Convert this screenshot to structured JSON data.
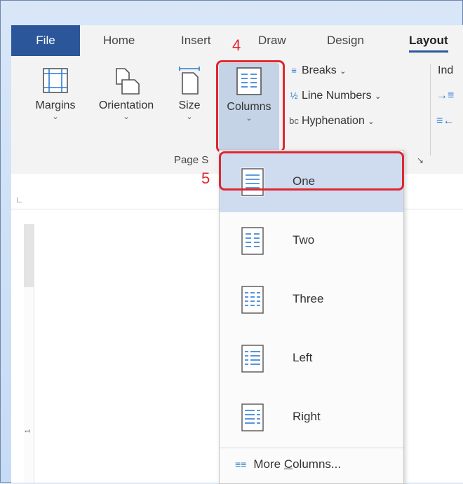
{
  "tabs": {
    "file": "File",
    "home": "Home",
    "insert": "Insert",
    "draw": "Draw",
    "design": "Design",
    "layout": "Layout"
  },
  "ribbon": {
    "margins": "Margins",
    "orientation": "Orientation",
    "size": "Size",
    "columns": "Columns",
    "breaks": "Breaks",
    "line_numbers": "Line Numbers",
    "hyphenation": "Hyphenation",
    "group_label": "Page S",
    "indent_partial": "Ind"
  },
  "steps": {
    "step4": "4",
    "step5": "5"
  },
  "columns_menu": {
    "items": [
      {
        "label": "One",
        "selected": true
      },
      {
        "label": "Two",
        "selected": false
      },
      {
        "label": "Three",
        "selected": false
      },
      {
        "label": "Left",
        "selected": false
      },
      {
        "label": "Right",
        "selected": false
      }
    ],
    "more_prefix": "More ",
    "more_underlined": "C",
    "more_suffix": "olumns..."
  },
  "ruler": {
    "vertical_mark": "1"
  },
  "colors": {
    "accent": "#2b579a",
    "highlight": "#e0262f",
    "icon_blue": "#2b7cd3",
    "selected_bg": "#cfdcf0"
  }
}
